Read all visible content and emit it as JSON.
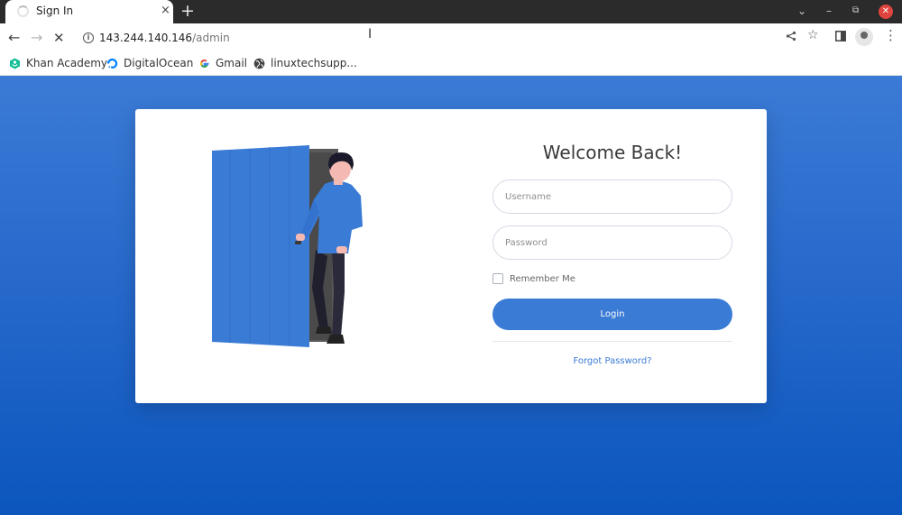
{
  "browser": {
    "tab": {
      "title": "Sign In",
      "close": "×"
    },
    "new_tab": "+",
    "window_controls": {
      "menu": "⌄",
      "minimize": "–",
      "restore": "⧉",
      "close": "✕"
    },
    "nav": {
      "back": "←",
      "forward": "→",
      "stop": "✕"
    },
    "url": {
      "host": "143.244.140.146",
      "path": "/admin"
    },
    "toolbar_icons": {
      "share": "⋖",
      "bookmark": "☆",
      "sidepanel": "▮",
      "menu": "⋮"
    },
    "bookmarks": [
      {
        "label": "Khan Academy",
        "icon": "khan-academy-icon",
        "color": "#14bf96"
      },
      {
        "label": "DigitalOcean",
        "icon": "digitalocean-icon",
        "color": "#0080ff"
      },
      {
        "label": "Gmail",
        "icon": "google-icon",
        "color": "#4285f4"
      },
      {
        "label": "linuxtechsupp...",
        "icon": "globe-icon",
        "color": "#444444"
      }
    ]
  },
  "login": {
    "title": "Welcome Back!",
    "username_placeholder": "Username",
    "password_placeholder": "Password",
    "remember_label": "Remember Me",
    "login_label": "Login",
    "forgot_label": "Forgot Password?"
  },
  "colors": {
    "accent": "#3a7bd5",
    "background_top": "#3b7bd6",
    "background_bottom": "#0b56bd",
    "door": "#3a7bd5"
  }
}
